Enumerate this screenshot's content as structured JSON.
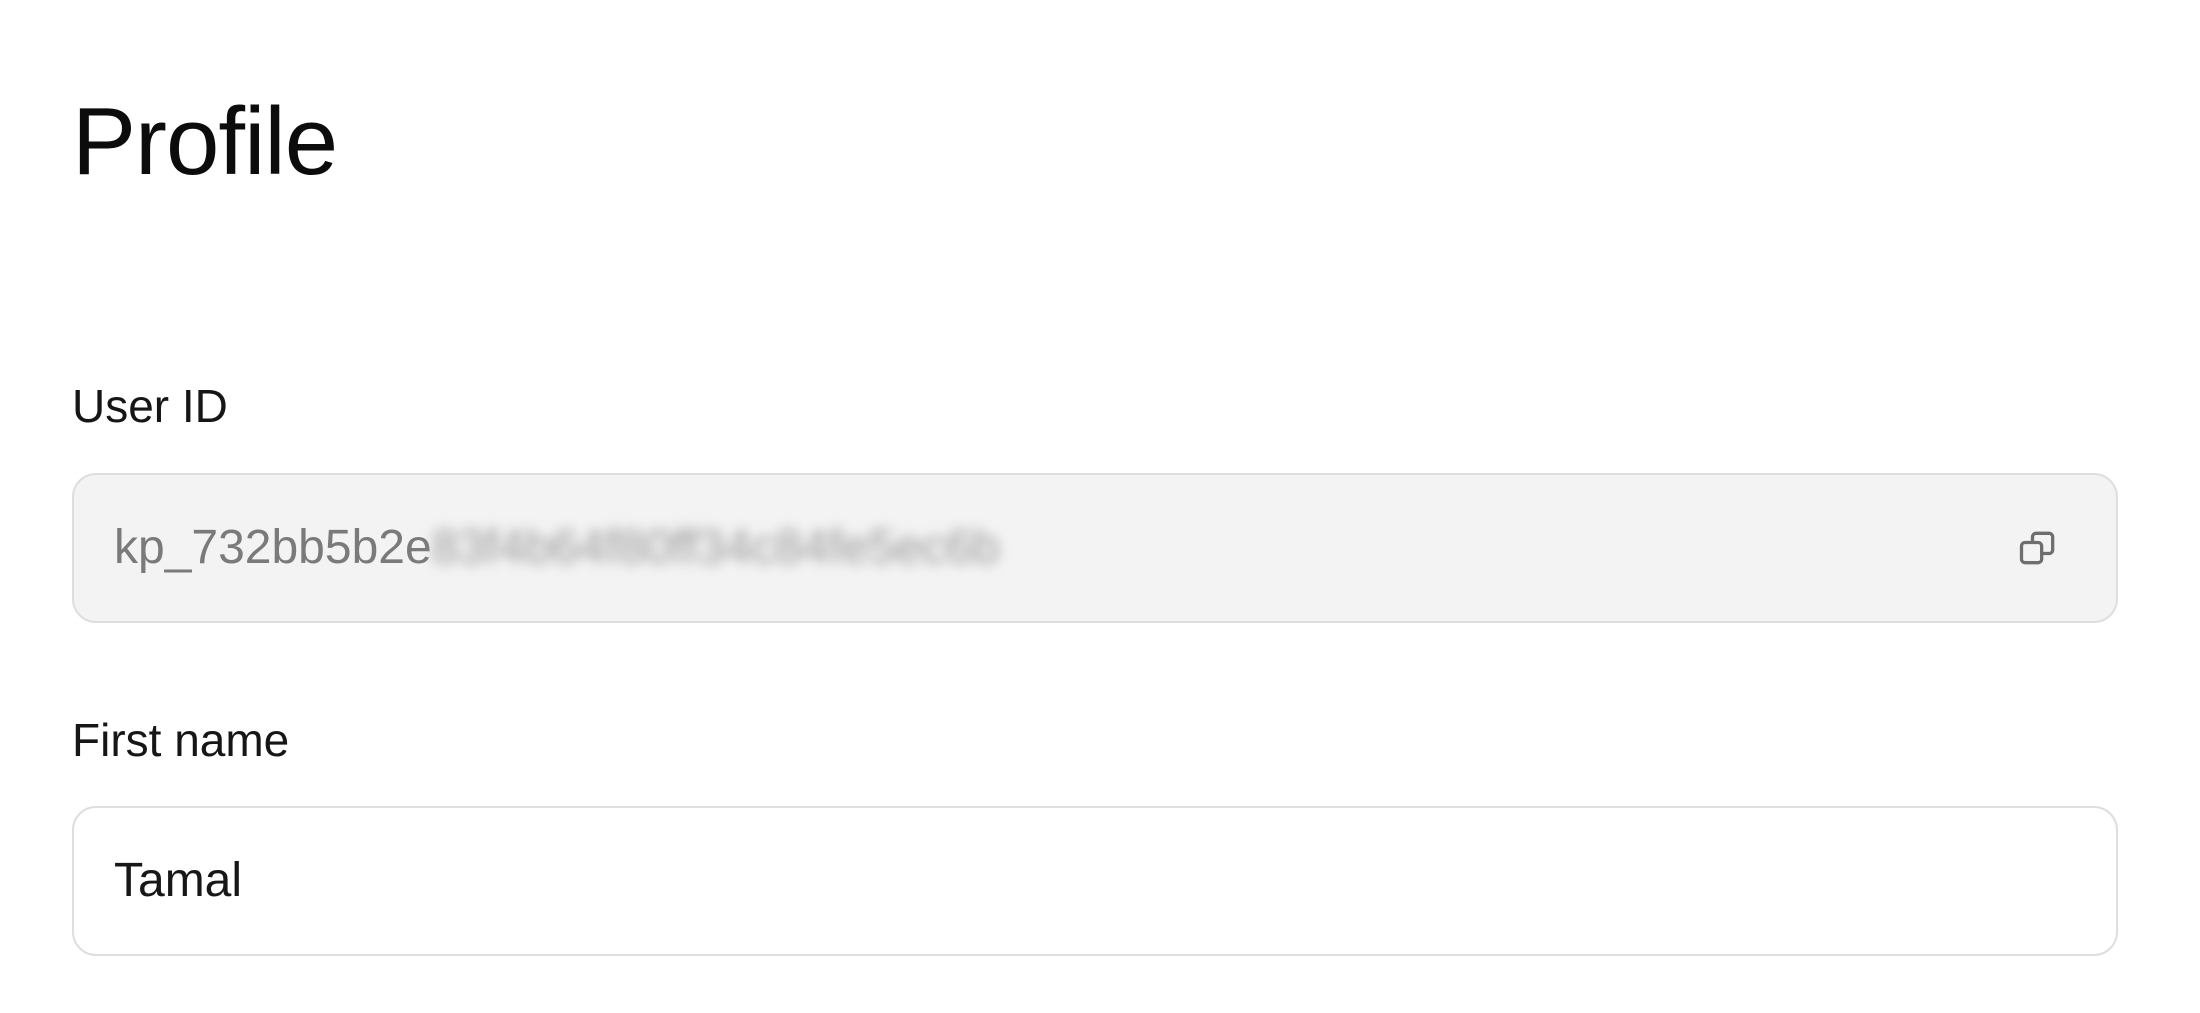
{
  "page": {
    "title": "Profile"
  },
  "fields": {
    "user_id": {
      "label": "User ID",
      "value_visible": "kp_732bb5b2e",
      "value_masked": "83f4b64f80ff34c84fe5ec6b",
      "copy_icon": "copy-icon"
    },
    "first_name": {
      "label": "First name",
      "value": "Tamal"
    }
  },
  "colors": {
    "readonly_field_bg": "#f3f3f3",
    "field_border": "#dedede",
    "muted_text": "#7a7a7a"
  }
}
